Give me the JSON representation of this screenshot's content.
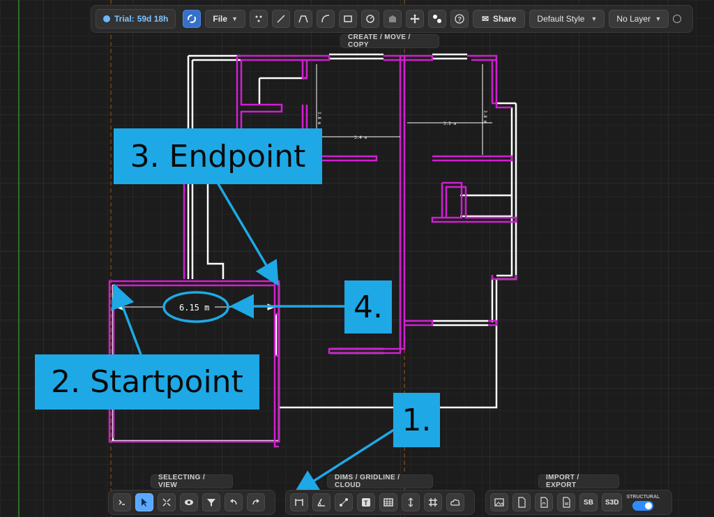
{
  "top_toolbar": {
    "trial_label": "Trial:",
    "trial_remaining": "59d 18h",
    "file_label": "File",
    "share_label": "Share",
    "style_select": "Default Style",
    "layer_select": "No Layer",
    "section_label": "CREATE / MOVE / COPY",
    "tools": [
      "point-icon",
      "line-icon",
      "polyline-icon",
      "arc-icon",
      "rectangle-icon",
      "circle-icon",
      "area-icon",
      "move-icon",
      "copy-icon",
      "help-icon"
    ]
  },
  "bottom_toolbars": {
    "selecting_label": "SELECTING / VIEW",
    "dims_label": "DIMS / GRIDLINE / CLOUD",
    "import_label": "IMPORT / EXPORT",
    "sb_label": "SB",
    "s3d_label": "S3D",
    "structural_label": "STRUCTURAL"
  },
  "drawing": {
    "dimension_main": "6.15 m",
    "dim_small_1": "3.4 m",
    "dim_small_2": "3.2 m",
    "dim_small_3": "3.8 m",
    "dim_small_4": "3.8 m"
  },
  "annotations": {
    "a1": "1.",
    "a2": "2. Startpoint",
    "a3": "3. Endpoint",
    "a4": "4."
  },
  "colors": {
    "wall": "#d21ed2",
    "line": "#ffffff",
    "annotation_bg": "#1ea9e6",
    "accent": "#5aa7ff"
  }
}
